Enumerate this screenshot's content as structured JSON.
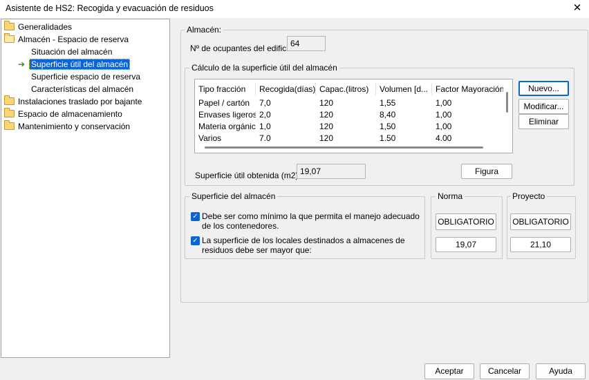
{
  "window": {
    "title": "Asistente de HS2: Recogida y evacuación de residuos",
    "close_glyph": "✕"
  },
  "tree": {
    "items": [
      {
        "label": "Generalidades",
        "icon": "folder-icon"
      },
      {
        "label": "Almacén - Espacio de reserva",
        "icon": "folder-open-icon"
      },
      {
        "label": "Situación del almacén"
      },
      {
        "label": "Superficie útil del almacén",
        "icon": "arrow-right-icon",
        "selected": true
      },
      {
        "label": "Superficie espacio de reserva"
      },
      {
        "label": "Características del almacén"
      },
      {
        "label": "Instalaciones traslado por bajante",
        "icon": "folder-icon"
      },
      {
        "label": "Espacio de almacenamiento",
        "icon": "folder-icon"
      },
      {
        "label": "Mantenimiento y conservación",
        "icon": "folder-icon"
      }
    ]
  },
  "almacen": {
    "group_label": "Almacén:",
    "ocupantes_label": "Nº de ocupantes del edificio:",
    "ocupantes_value": "64"
  },
  "calculo": {
    "group_label": "Cálculo de la superficie útil del almacén",
    "columns": [
      "Tipo fracción",
      "Recogida(días)",
      "Capac.(litros)",
      "Volumen [d...",
      "Factor Mayoración"
    ],
    "rows": [
      [
        "Papel / cartón",
        "7,0",
        "120",
        "1,55",
        "1,00"
      ],
      [
        "Envases ligeros",
        "2,0",
        "120",
        "8,40",
        "1,00"
      ],
      [
        "Materia orgánica",
        "1,0",
        "120",
        "1,50",
        "1,00"
      ],
      [
        "Varios",
        "7.0",
        "120",
        "1.50",
        "4.00"
      ]
    ],
    "buttons": {
      "nuevo": "Nuevo...",
      "modificar": "Modificar...",
      "eliminar": "Eliminar",
      "figura": "Figura"
    },
    "superficie_label": "Superficie útil obtenida (m2):",
    "superficie_value": "19,07"
  },
  "superficie": {
    "group_label": "Superficie del almacén",
    "check1": "Debe ser como mínimo la que permita el manejo adecuado de los contenedores.",
    "check2": "La superficie de los locales destinados a almacenes de residuos debe ser mayor que:",
    "norma": {
      "label": "Norma",
      "status": "OBLIGATORIO",
      "value": "19,07"
    },
    "proyecto": {
      "label": "Proyecto",
      "status": "OBLIGATORIO",
      "value": "21,10"
    }
  },
  "footer": {
    "aceptar": "Aceptar",
    "cancelar": "Cancelar",
    "ayuda": "Ayuda"
  }
}
